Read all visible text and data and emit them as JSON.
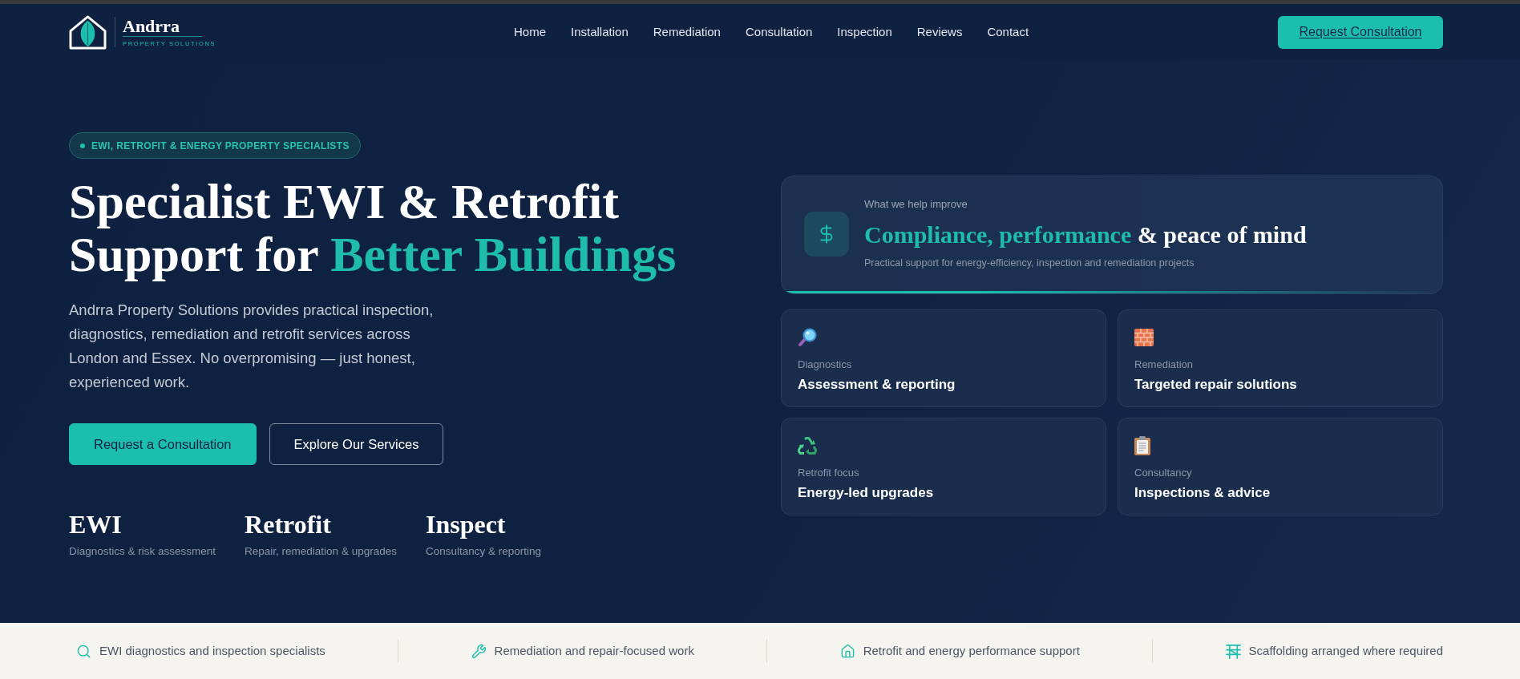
{
  "header": {
    "logo": {
      "name": "Andrra",
      "tagline": "PROPERTY SOLUTIONS"
    },
    "nav": [
      {
        "label": "Home"
      },
      {
        "label": "Installation"
      },
      {
        "label": "Remediation"
      },
      {
        "label": "Consultation"
      },
      {
        "label": "Inspection"
      },
      {
        "label": "Reviews"
      },
      {
        "label": "Contact"
      }
    ],
    "cta": "Request Consultation"
  },
  "hero": {
    "badge": "EWI, RETROFIT & ENERGY PROPERTY SPECIALISTS",
    "title": "Specialist EWI & Retrofit Support for",
    "title_highlight": "Better Buildings",
    "intro": "Andrra Property Solutions provides practical inspection, diagnostics, remediation and retrofit services across London and Essex. No overpromising — just honest, experienced work.",
    "buttons": [
      {
        "label": "Request a Consultation",
        "kind": "primary"
      },
      {
        "label": "Explore Our Services",
        "kind": "outline"
      }
    ],
    "stats": [
      {
        "value": "EWI",
        "caption": "Diagnostics & risk assessment"
      },
      {
        "value": "Retrofit",
        "caption": "Repair, remediation & upgrades"
      },
      {
        "value": "Inspect",
        "caption": "Consultancy & reporting"
      }
    ]
  },
  "focus_card": {
    "eyebrow": "What we help improve",
    "title_highlight": "Compliance, performance",
    "title": "& peace of mind",
    "subtitle": "Practical support for energy-efficiency, inspection and remediation projects"
  },
  "service_cards": [
    {
      "label": "Diagnostics",
      "title": "Assessment & reporting"
    },
    {
      "label": "Remediation",
      "title": "Targeted repair solutions"
    },
    {
      "label": "Retrofit focus",
      "title": "Energy-led upgrades"
    },
    {
      "label": "Consultancy",
      "title": "Inspections & advice"
    }
  ],
  "features_strip": [
    {
      "text": "EWI diagnostics and inspection specialists"
    },
    {
      "text": "Remediation and repair-focused work"
    },
    {
      "text": "Retrofit and energy performance support"
    },
    {
      "text": "Scaffolding arranged where required"
    }
  ]
}
